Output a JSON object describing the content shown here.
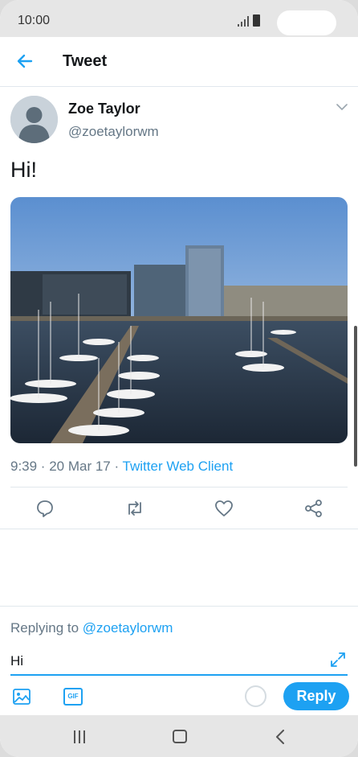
{
  "status_bar": {
    "time": "10:00"
  },
  "header": {
    "title": "Tweet"
  },
  "tweet": {
    "author_name": "Zoe Taylor",
    "author_handle": "@zoetaylorwm",
    "text": "Hi!",
    "timestamp": "9:39 · 20 Mar 17 · ",
    "client": "Twitter Web Client"
  },
  "reply": {
    "replying_prefix": "Replying to ",
    "replying_handle": "@zoetaylorwm",
    "input_value": "Hi",
    "button_label": "Reply",
    "gif_label": "GIF"
  },
  "colors": {
    "accent": "#1da1f2",
    "secondary_text": "#657786",
    "divider": "#e1e8ed"
  },
  "icons": [
    "back-arrow-icon",
    "chevron-down-icon",
    "comment-icon",
    "retweet-icon",
    "like-icon",
    "share-icon",
    "expand-icon",
    "image-icon",
    "gif-icon",
    "recents-icon",
    "home-icon",
    "nav-back-icon"
  ]
}
